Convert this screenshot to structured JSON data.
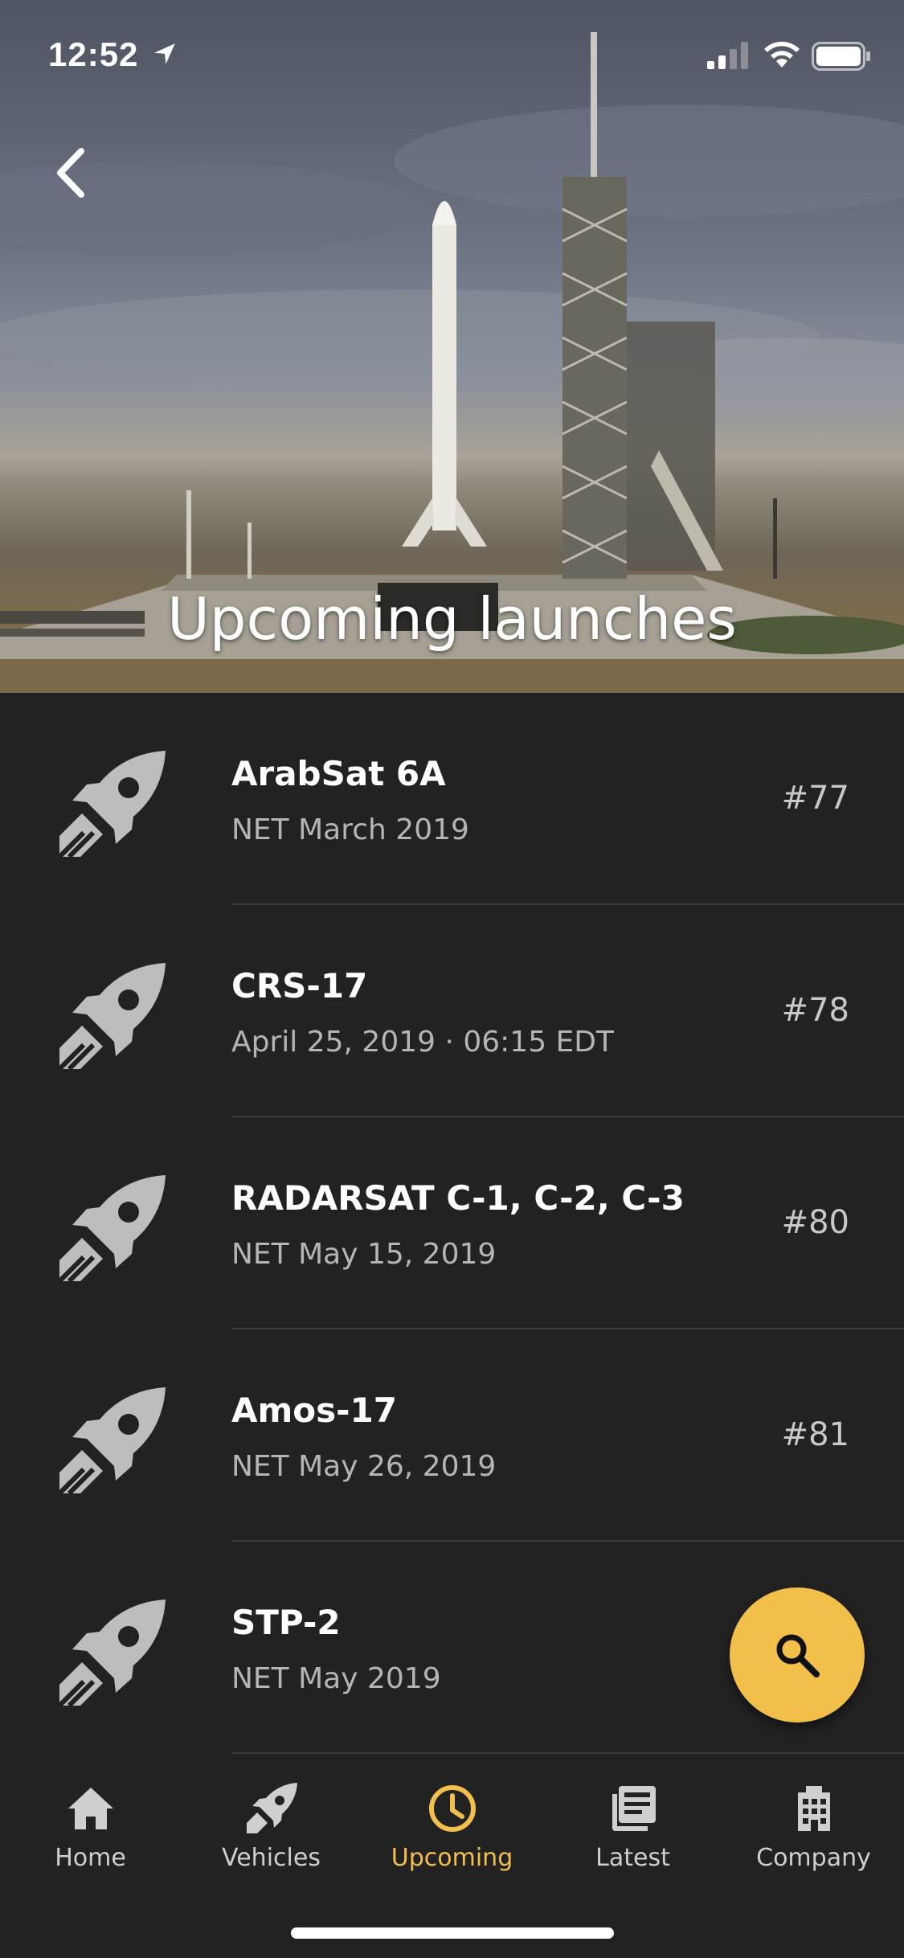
{
  "status_bar": {
    "time": "12:52"
  },
  "header": {
    "title": "Upcoming launches"
  },
  "launches": [
    {
      "name": "ArabSat 6A",
      "date": "NET March 2019",
      "number": "#77"
    },
    {
      "name": "CRS-17",
      "date": "April 25, 2019 · 06:15 EDT",
      "number": "#78"
    },
    {
      "name": "RADARSAT C-1, C-2, C-3",
      "date": "NET May 15, 2019",
      "number": "#80"
    },
    {
      "name": "Amos-17",
      "date": "NET May 26, 2019",
      "number": "#81"
    },
    {
      "name": "STP-2",
      "date": "NET May 2019",
      "number": ""
    }
  ],
  "nav": {
    "items": [
      {
        "label": "Home",
        "icon": "home-icon"
      },
      {
        "label": "Vehicles",
        "icon": "rocket-icon"
      },
      {
        "label": "Upcoming",
        "icon": "clock-icon"
      },
      {
        "label": "Latest",
        "icon": "news-icon"
      },
      {
        "label": "Company",
        "icon": "building-icon"
      }
    ],
    "active": "Upcoming"
  },
  "colors": {
    "background": "#222222",
    "accent": "#f2c04a",
    "icon_gray": "#bdbdbd",
    "secondary_text": "#b5b5b5"
  }
}
